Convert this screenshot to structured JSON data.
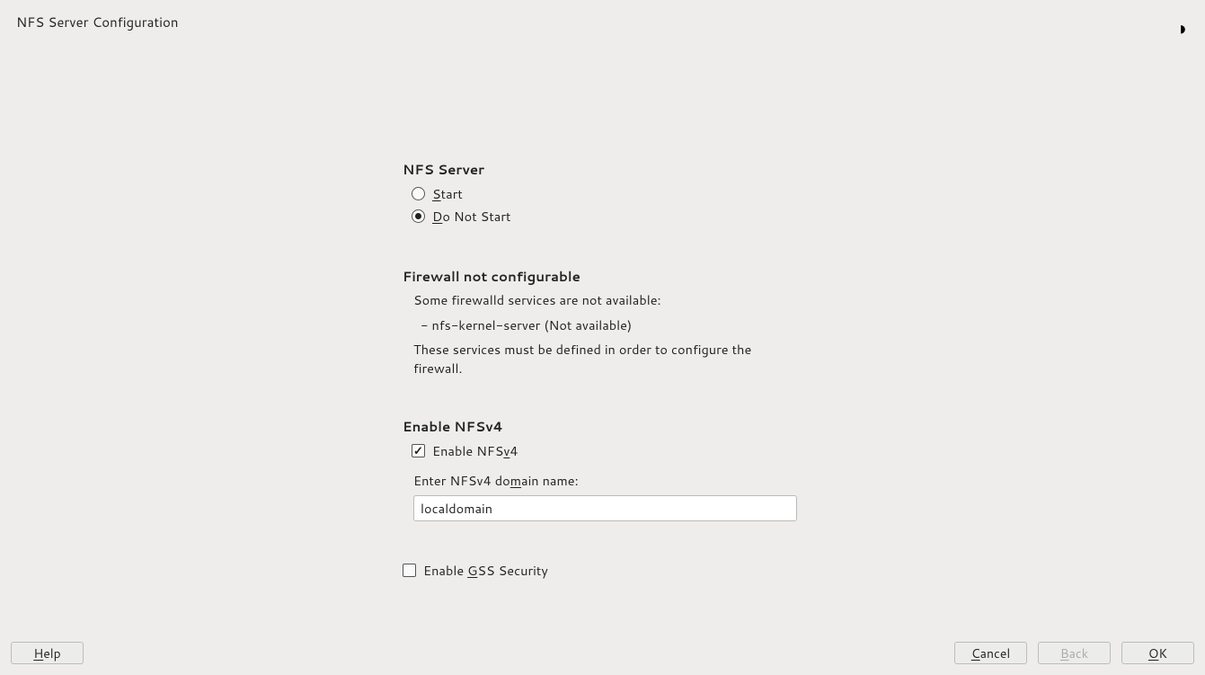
{
  "title": "NFS Server Configuration",
  "nfsServer": {
    "heading": "NFS Server",
    "start_pre": "",
    "start_u": "S",
    "start_post": "tart",
    "dont_pre": "",
    "dont_u": "D",
    "dont_post": "o Not Start",
    "selected": "donotstart"
  },
  "firewall": {
    "heading": "Firewall not configurable",
    "desc": "Some firewalld services are not available:",
    "item": "- nfs-kernel-server (Not available)",
    "note": "These services must be defined in order to configure the firewall."
  },
  "nfsv4": {
    "heading": "Enable NFSv4",
    "cb_pre": "Enable NFS",
    "cb_u": "v",
    "cb_post": "4",
    "checked": true,
    "domain_label_pre": "Enter NFSv4 do",
    "domain_label_u": "m",
    "domain_label_post": "ain name:",
    "domain_value": "localdomain"
  },
  "gss": {
    "cb_pre": "Enable ",
    "cb_u": "G",
    "cb_post": "SS Security",
    "checked": false
  },
  "buttons": {
    "help_u": "H",
    "help_post": "elp",
    "cancel_u": "C",
    "cancel_post": "ancel",
    "back_u": "B",
    "back_post": "ack",
    "ok_u": "O",
    "ok_post": "K"
  }
}
